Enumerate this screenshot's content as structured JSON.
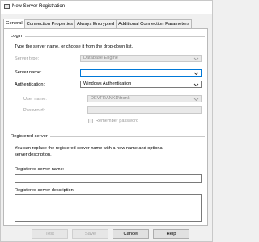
{
  "window": {
    "title": "New Server Registration"
  },
  "tabs": [
    {
      "label": "General"
    },
    {
      "label": "Connection Properties"
    },
    {
      "label": "Always Encrypted"
    },
    {
      "label": "Additional Connection Parameters"
    }
  ],
  "login": {
    "section_title": "Login",
    "instructions": "Type the server name, or choose it from the drop-down list.",
    "server_type_label": "Server type:",
    "server_type_value": "Database Engine",
    "server_name_label": "Server name:",
    "server_name_value": "",
    "authentication_label": "Authentication:",
    "authentication_value": "Windows Authentication",
    "user_name_label": "User name:",
    "user_name_value": "DEVFRANKD\\frank",
    "password_label": "Password:",
    "password_value": "",
    "remember_password_label": "Remember password"
  },
  "registered": {
    "section_title": "Registered server",
    "instructions_line1": "You can replace the registered server name with a new name and optional",
    "instructions_line2": "server description.",
    "name_label": "Registered server name:",
    "name_value": "",
    "description_label": "Registered server description:",
    "description_value": ""
  },
  "buttons": {
    "test": "Test",
    "save": "Save",
    "cancel": "Cancel",
    "help": "Help"
  }
}
